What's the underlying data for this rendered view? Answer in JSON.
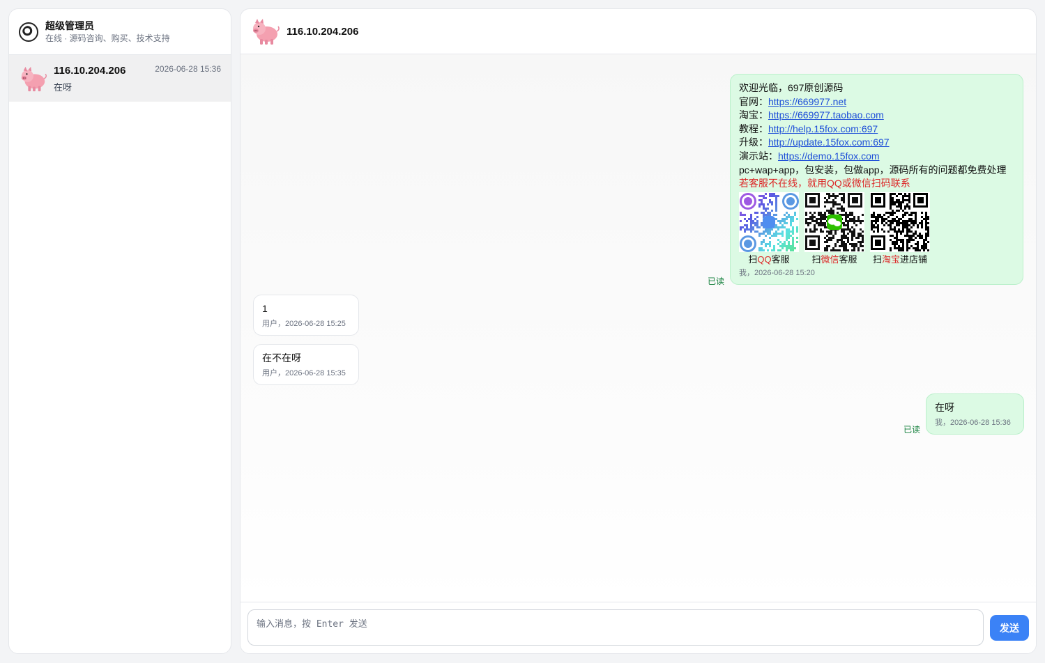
{
  "sidebar": {
    "admin": {
      "name": "超级管理员",
      "status": "在线 · 源码咨询、购买、技术支持"
    },
    "conversations": [
      {
        "title": "116.10.204.206",
        "last_message": "在呀",
        "time": "2026-06-28 15:36"
      }
    ]
  },
  "chat": {
    "title": "116.10.204.206",
    "messages": [
      {
        "sender": "me",
        "lines": {
          "welcome": "欢迎光临，697原创源码",
          "site_label": "官网：",
          "site_url": "https://669977.net",
          "taobao_label": "淘宝：",
          "taobao_url": "https://669977.taobao.com",
          "tutorial_label": "教程：",
          "tutorial_url": "http://help.15fox.com:697",
          "upgrade_label": "升级：",
          "upgrade_url": "http://update.15fox.com:697",
          "demo_label": "演示站：",
          "demo_url": "https://demo.15fox.com",
          "features": "pc+wap+app，包安装，包做app，源码所有的问题都免费处理",
          "notice": "若客服不在线，就用QQ或微信扫码联系"
        },
        "qr_captions": [
          {
            "pre": "扫",
            "hl": "QQ",
            "post": "客服"
          },
          {
            "pre": "扫",
            "hl": "微信",
            "post": "客服"
          },
          {
            "pre": "扫",
            "hl": "淘宝",
            "post": "进店铺"
          }
        ],
        "meta": "我，2026-06-28 15:20",
        "read": "已读"
      },
      {
        "sender": "user",
        "text": "1",
        "meta": "用户，2026-06-28 15:25"
      },
      {
        "sender": "user",
        "text": "在不在呀",
        "meta": "用户，2026-06-28 15:35"
      },
      {
        "sender": "me",
        "text": "在呀",
        "meta": "我，2026-06-28 15:36",
        "read": "已读"
      }
    ],
    "input": {
      "placeholder": "输入消息，按 Enter 发送",
      "value": ""
    },
    "send_label": "发送"
  },
  "colors": {
    "accent": "#3b82f6",
    "my_bubble": "#dcfae4",
    "read": "#15803d",
    "highlight": "#dc2626"
  }
}
